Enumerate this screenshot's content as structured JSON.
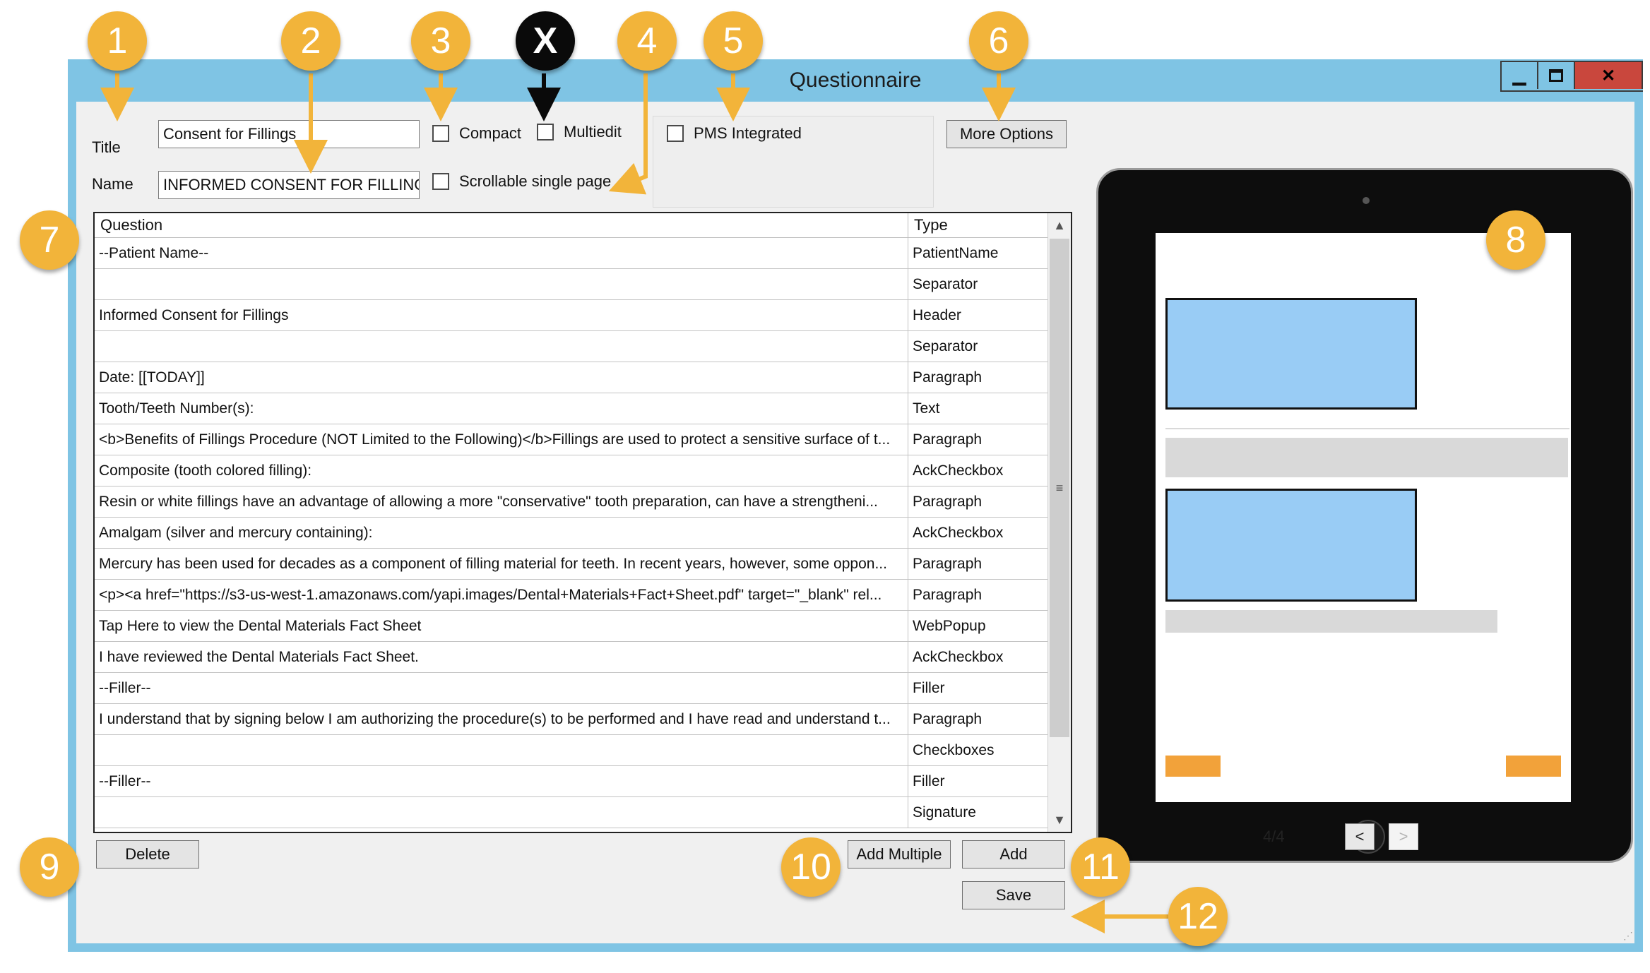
{
  "window": {
    "title": "Questionnaire",
    "controls": [
      "minimize",
      "maximize",
      "close"
    ]
  },
  "form": {
    "title_label": "Title",
    "title_value": "Consent for Fillings",
    "name_label": "Name",
    "name_value": "INFORMED CONSENT FOR FILLING",
    "compact_label": "Compact",
    "multiedit_label": "Multiedit",
    "scrollable_label": "Scrollable single page",
    "pms_label": "PMS Integrated",
    "more_options_label": "More Options"
  },
  "grid": {
    "columns": [
      "Question",
      "Type"
    ],
    "rows": [
      {
        "question": "--Patient Name--",
        "type": "PatientName"
      },
      {
        "question": "",
        "type": "Separator"
      },
      {
        "question": "Informed Consent for Fillings",
        "type": "Header"
      },
      {
        "question": "",
        "type": "Separator"
      },
      {
        "question": "Date: [[TODAY]]",
        "type": "Paragraph"
      },
      {
        "question": "Tooth/Teeth Number(s):",
        "type": "Text"
      },
      {
        "question": "<b>Benefits of Fillings Procedure (NOT Limited to the Following)</b>Fillings are used to protect a sensitive surface of t...",
        "type": "Paragraph"
      },
      {
        "question": "Composite (tooth colored filling):",
        "type": "AckCheckbox"
      },
      {
        "question": "Resin or white fillings have an advantage of allowing a more \"conservative\" tooth preparation, can have a strengtheni...",
        "type": "Paragraph"
      },
      {
        "question": "Amalgam (silver and mercury containing):",
        "type": "AckCheckbox"
      },
      {
        "question": "Mercury has been used for decades as a component of filling material for teeth. In recent years, however, some oppon...",
        "type": "Paragraph"
      },
      {
        "question": "<p><a href=\"https://s3-us-west-1.amazonaws.com/yapi.images/Dental+Materials+Fact+Sheet.pdf\" target=\"_blank\" rel...",
        "type": "Paragraph"
      },
      {
        "question": "Tap Here to view the Dental Materials Fact Sheet",
        "type": "WebPopup"
      },
      {
        "question": "I have reviewed the Dental Materials Fact Sheet.",
        "type": "AckCheckbox"
      },
      {
        "question": "--Filler--",
        "type": "Filler"
      },
      {
        "question": "I understand that by signing below I am authorizing the procedure(s) to be performed and I have read and understand t...",
        "type": "Paragraph"
      },
      {
        "question": "",
        "type": "Checkboxes"
      },
      {
        "question": "--Filler--",
        "type": "Filler"
      },
      {
        "question": "",
        "type": "Signature"
      }
    ]
  },
  "buttons": {
    "delete": "Delete",
    "add_multiple": "Add Multiple",
    "add": "Add",
    "save": "Save"
  },
  "preview": {
    "page_indicator": "4/4",
    "prev": "<",
    "next": ">",
    "colors": {
      "block": "#99ccf5",
      "bar": "#d9d9d9",
      "nav": "#f2a23a"
    }
  },
  "callouts": [
    "1",
    "2",
    "3",
    "X",
    "4",
    "5",
    "6",
    "7",
    "8",
    "9",
    "10",
    "11",
    "12"
  ],
  "colors": {
    "callout": "#f2b43a",
    "titlebar": "#7fc4e4",
    "close": "#c9473d"
  }
}
